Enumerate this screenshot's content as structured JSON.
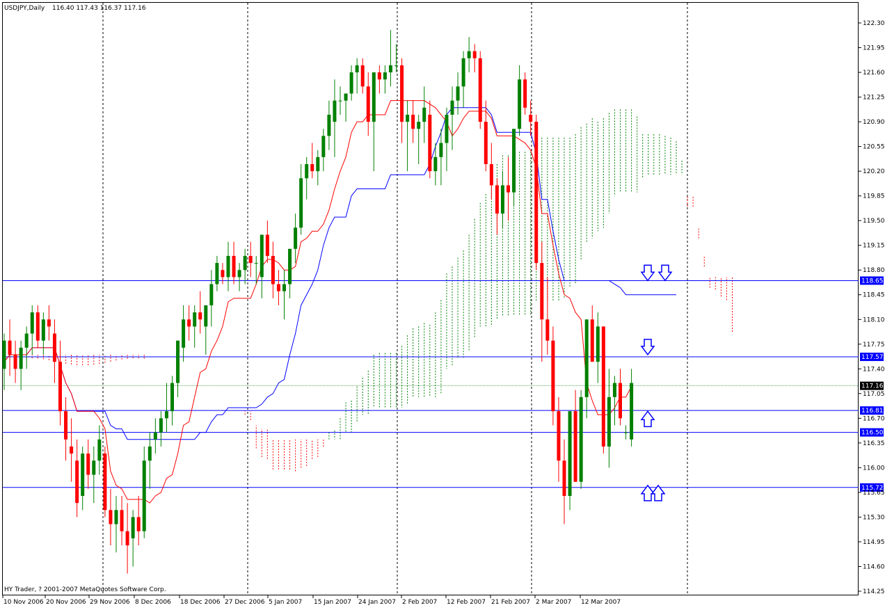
{
  "chart_data": {
    "type": "candlestick",
    "symbol_header": "USDJPY,Daily",
    "ohlc_header": "116.40 117.43 116.37 117.16",
    "copyright": "HY Trader, ? 2001-2007 MetaQuotes Software Corp.",
    "ylim": [
      114.25,
      122.3
    ],
    "y_ticks": [
      "122.30",
      "121.95",
      "121.60",
      "121.25",
      "120.90",
      "120.55",
      "120.20",
      "119.85",
      "119.50",
      "119.15",
      "118.80",
      "118.45",
      "118.10",
      "117.75",
      "117.40",
      "117.05",
      "116.70",
      "116.35",
      "116.00",
      "115.65",
      "115.30",
      "114.95",
      "114.60",
      "114.25"
    ],
    "x_labels": [
      "10 Nov 2006",
      "20 Nov 2006",
      "29 Nov 2006",
      "8 Dec 2006",
      "18 Dec 2006",
      "27 Dec 2006",
      "5 Jan 2007",
      "15 Jan 2007",
      "24 Jan 2007",
      "2 Feb 2007",
      "12 Feb 2007",
      "21 Feb 2007",
      "2 Mar 2007",
      "12 Mar 2007"
    ],
    "current_price": "117.16",
    "levels": [
      {
        "label": "118.65",
        "value": 118.65
      },
      {
        "label": "117.57",
        "value": 117.57
      },
      {
        "label": "116.81",
        "value": 116.81
      },
      {
        "label": "116.50",
        "value": 116.5
      },
      {
        "label": "115.72",
        "value": 115.72
      }
    ],
    "markers": [
      {
        "type": "hollow-down-arrow",
        "at": 118.75
      },
      {
        "type": "hollow-down-arrow",
        "at": 118.75
      },
      {
        "type": "hollow-down-arrow",
        "at": 117.7
      },
      {
        "type": "hollow-up-arrow",
        "at": 116.7
      },
      {
        "type": "hollow-up-arrow",
        "at": 115.65
      },
      {
        "type": "hollow-up-arrow",
        "at": 115.65
      }
    ],
    "colors": {
      "bull": "#008000",
      "bear": "#ff0000",
      "tenkan": "#ff0000",
      "kijun": "#0000ff",
      "level": "#0000ff",
      "cloud_bull": "#008000",
      "cloud_bear": "#ff0000"
    },
    "ohlc": [
      [
        117.4,
        117.9,
        117.1,
        117.8
      ],
      [
        117.8,
        118.1,
        117.3,
        117.6
      ],
      [
        117.6,
        117.8,
        117.2,
        117.4
      ],
      [
        117.4,
        117.8,
        117.1,
        117.7
      ],
      [
        117.7,
        118.0,
        117.4,
        117.9
      ],
      [
        117.9,
        118.3,
        117.6,
        118.2
      ],
      [
        118.2,
        118.3,
        117.7,
        117.8
      ],
      [
        117.8,
        118.2,
        117.6,
        118.1
      ],
      [
        118.1,
        118.3,
        117.8,
        118.0
      ],
      [
        117.9,
        118.1,
        117.2,
        117.5
      ],
      [
        117.5,
        117.8,
        116.6,
        116.8
      ],
      [
        116.8,
        117.0,
        116.1,
        116.4
      ],
      [
        116.3,
        116.7,
        115.8,
        116.2
      ],
      [
        116.1,
        116.4,
        115.3,
        115.5
      ],
      [
        115.6,
        116.3,
        115.4,
        116.2
      ],
      [
        116.2,
        116.4,
        115.7,
        115.9
      ],
      [
        115.9,
        116.3,
        115.5,
        116.1
      ],
      [
        116.1,
        116.6,
        115.9,
        116.4
      ],
      [
        116.2,
        116.3,
        115.3,
        115.4
      ],
      [
        115.4,
        115.7,
        114.9,
        115.2
      ],
      [
        115.2,
        115.6,
        114.8,
        115.4
      ],
      [
        115.4,
        115.6,
        114.9,
        115.1
      ],
      [
        115.1,
        115.5,
        114.5,
        114.9
      ],
      [
        115.0,
        115.4,
        114.6,
        115.3
      ],
      [
        115.3,
        115.6,
        114.9,
        115.1
      ],
      [
        115.1,
        116.3,
        115.0,
        116.1
      ],
      [
        116.1,
        116.5,
        115.7,
        116.3
      ],
      [
        116.4,
        116.7,
        116.2,
        116.5
      ],
      [
        116.5,
        116.8,
        116.3,
        116.7
      ],
      [
        116.7,
        117.2,
        116.5,
        116.8
      ],
      [
        116.8,
        117.3,
        116.6,
        117.2
      ],
      [
        117.2,
        117.8,
        117.0,
        117.8
      ],
      [
        117.7,
        118.3,
        117.5,
        118.1
      ],
      [
        118.1,
        118.3,
        117.8,
        118.0
      ],
      [
        118.0,
        118.3,
        117.7,
        118.2
      ],
      [
        118.2,
        118.5,
        117.9,
        118.1
      ],
      [
        118.0,
        118.3,
        117.6,
        118.3
      ],
      [
        118.3,
        118.8,
        118.0,
        118.6
      ],
      [
        118.6,
        119.0,
        118.5,
        118.9
      ],
      [
        118.8,
        118.9,
        118.6,
        118.7
      ],
      [
        118.7,
        119.2,
        118.5,
        119.0
      ],
      [
        119.0,
        119.2,
        118.6,
        118.7
      ],
      [
        118.7,
        118.9,
        118.5,
        118.8
      ],
      [
        118.8,
        119.1,
        118.6,
        119.0
      ],
      [
        119.0,
        119.2,
        118.7,
        118.9
      ],
      [
        118.9,
        119.0,
        118.6,
        118.9
      ],
      [
        118.7,
        119.3,
        118.4,
        119.3
      ],
      [
        119.3,
        119.5,
        118.9,
        119.0
      ],
      [
        119.0,
        119.2,
        118.4,
        118.6
      ],
      [
        118.6,
        118.8,
        118.3,
        118.5
      ],
      [
        118.5,
        118.8,
        118.1,
        118.6
      ],
      [
        118.6,
        119.1,
        118.4,
        119.1
      ],
      [
        119.1,
        119.6,
        118.9,
        119.4
      ],
      [
        119.4,
        120.3,
        119.3,
        120.1
      ],
      [
        120.1,
        120.4,
        119.8,
        120.3
      ],
      [
        120.3,
        120.6,
        120.1,
        120.2
      ],
      [
        120.2,
        120.5,
        120.0,
        120.4
      ],
      [
        120.4,
        120.8,
        120.2,
        120.7
      ],
      [
        120.7,
        121.2,
        120.5,
        121.0
      ],
      [
        120.9,
        121.5,
        120.4,
        121.2
      ],
      [
        121.2,
        121.4,
        121.0,
        121.2
      ],
      [
        121.2,
        121.3,
        120.9,
        121.3
      ],
      [
        121.3,
        121.7,
        121.2,
        121.6
      ],
      [
        121.6,
        121.8,
        121.3,
        121.7
      ],
      [
        121.7,
        121.8,
        121.3,
        121.4
      ],
      [
        121.4,
        121.6,
        120.7,
        120.9
      ],
      [
        120.9,
        121.6,
        120.2,
        121.6
      ],
      [
        121.6,
        121.7,
        121.3,
        121.5
      ],
      [
        121.5,
        121.7,
        121.3,
        121.6
      ],
      [
        121.6,
        122.2,
        121.4,
        121.7
      ],
      [
        121.7,
        122.0,
        121.6,
        121.7
      ],
      [
        121.7,
        121.8,
        120.6,
        120.9
      ],
      [
        120.9,
        121.2,
        120.2,
        121.0
      ],
      [
        121.0,
        121.2,
        120.6,
        120.8
      ],
      [
        120.8,
        121.0,
        120.3,
        120.9
      ],
      [
        120.9,
        121.4,
        120.6,
        121.1
      ],
      [
        121.0,
        121.2,
        120.1,
        120.2
      ],
      [
        120.2,
        120.6,
        120.0,
        120.4
      ],
      [
        120.4,
        120.8,
        120.0,
        120.6
      ],
      [
        120.6,
        121.1,
        120.2,
        121.0
      ],
      [
        121.0,
        121.4,
        120.5,
        121.2
      ],
      [
        121.2,
        121.6,
        121.0,
        121.4
      ],
      [
        121.4,
        121.9,
        121.1,
        121.8
      ],
      [
        121.8,
        122.1,
        121.6,
        121.9
      ],
      [
        121.9,
        122.0,
        121.6,
        121.8
      ],
      [
        121.8,
        121.9,
        120.8,
        120.9
      ],
      [
        120.9,
        121.2,
        120.2,
        120.3
      ],
      [
        120.3,
        120.6,
        119.8,
        120.0
      ],
      [
        120.0,
        120.1,
        119.3,
        119.6
      ],
      [
        119.6,
        120.2,
        119.4,
        120.0
      ],
      [
        120.0,
        120.4,
        119.5,
        119.9
      ],
      [
        119.9,
        120.7,
        119.7,
        120.8
      ],
      [
        120.8,
        121.7,
        120.7,
        121.5
      ],
      [
        121.5,
        121.6,
        121.0,
        121.1
      ],
      [
        121.0,
        121.2,
        120.7,
        120.9
      ],
      [
        120.9,
        121.0,
        118.8,
        118.9
      ],
      [
        118.9,
        119.2,
        117.5,
        118.1
      ],
      [
        118.1,
        118.7,
        117.6,
        117.8
      ],
      [
        117.8,
        118.0,
        116.6,
        116.8
      ],
      [
        116.8,
        117.0,
        115.8,
        116.1
      ],
      [
        116.1,
        116.4,
        115.2,
        115.6
      ],
      [
        115.6,
        116.8,
        115.4,
        116.8
      ],
      [
        116.8,
        117.1,
        115.8,
        115.8
      ],
      [
        115.8,
        117.1,
        115.7,
        117.0
      ],
      [
        117.0,
        118.1,
        116.7,
        118.1
      ],
      [
        118.1,
        118.3,
        117.6,
        117.5
      ],
      [
        117.5,
        118.2,
        117.2,
        118.0
      ],
      [
        118.0,
        118.0,
        116.2,
        116.3
      ],
      [
        116.3,
        117.4,
        116.0,
        117.0
      ],
      [
        117.0,
        117.3,
        116.6,
        117.2
      ],
      [
        117.2,
        117.4,
        116.6,
        116.7
      ],
      [
        116.5,
        116.6,
        116.4,
        116.5
      ],
      [
        116.4,
        117.4,
        116.3,
        117.2
      ]
    ]
  }
}
